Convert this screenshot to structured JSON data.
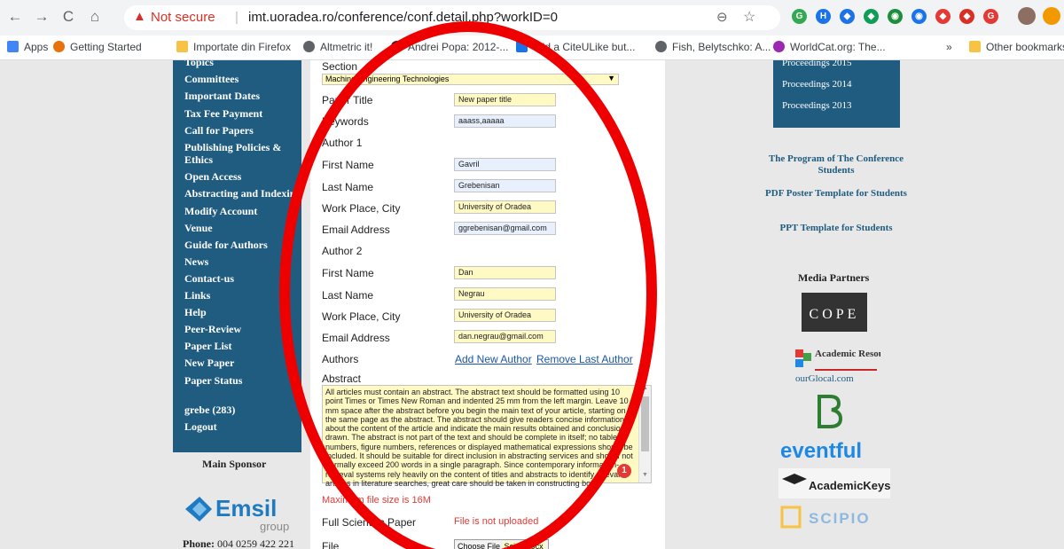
{
  "browser": {
    "back": "←",
    "forward": "→",
    "reload": "C",
    "home": "⌂",
    "warning_icon": "▲",
    "security_label": "Not secure",
    "url_separator": "|",
    "url": "imt.uoradea.ro/conference/conf.detail.php?workID=0",
    "zoom_icon": "⊖",
    "star_icon": "☆",
    "extensions": [
      "G",
      "H",
      "◆",
      "◆",
      "◉",
      "◉",
      "◆",
      "◆",
      "G"
    ],
    "extension_colors": [
      "#34a853",
      "#1a73e8",
      "#1a73e8",
      "#0f9d58",
      "#1e8e3e",
      "#1a73e8",
      "#e53935",
      "#d93025",
      "#e53935"
    ]
  },
  "bookmarks": {
    "items": [
      "Apps",
      "Getting Started",
      "Importate din Firefox",
      "Altmetric it!",
      "Andrei Popa: 2012-...",
      "add a CiteULike but...",
      "Fish, Belytschko: A...",
      "WorldCat.org: The..."
    ],
    "overflow": "»",
    "other": "Other bookmarks"
  },
  "left_nav": {
    "items": [
      "Topics",
      "Committees",
      "Important Dates",
      "Tax Fee Payment",
      "Call for Papers",
      "Publishing Policies &",
      "Ethics",
      "Open Access",
      "Abstracting and Indexing",
      "Modify Account",
      "Venue",
      "Guide for Authors",
      "News",
      "Contact-us",
      "Links",
      "Help",
      "Peer-Review",
      "Paper List",
      "New Paper",
      "Paper Status"
    ],
    "user": "grebe (283)",
    "logout": "Logout"
  },
  "sponsor": {
    "title": "Main Sponsor",
    "logo_text": "Emsil",
    "logo_sub": "group",
    "phone_label": "Phone:",
    "phone": "004 0259 422 221"
  },
  "form": {
    "section_label": "Section",
    "section_value": "Machine Engineering Technologies",
    "paper_title_label": "Paper Title",
    "paper_title_value": "New paper title",
    "keywords_label": "Keywords",
    "keywords_value": "aaass,aaaaa",
    "author1_heading": "Author 1",
    "author1": {
      "first_label": "First Name",
      "first": "Gavril",
      "last_label": "Last Name",
      "last": "Grebenisan",
      "work_label": "Work Place, City",
      "work": "University of Oradea",
      "email_label": "Email Address",
      "email": "ggrebenisan@gmail.com"
    },
    "author2_heading": "Author 2",
    "author2": {
      "first_label": "First Name",
      "first": "Dan",
      "last_label": "Last Name",
      "last": "Negrau",
      "work_label": "Work Place, City",
      "work": "University of Oradea",
      "email_label": "Email Address",
      "email": "dan.negrau@gmail.com"
    },
    "authors_label": "Authors",
    "add_author": "Add New Author",
    "remove_author": "Remove Last Author",
    "abstract_label": "Abstract",
    "abstract_text": "All articles must contain an abstract. The abstract text should be formatted using 10 point Times or Times New Roman and indented 25 mm from the left margin. Leave 10 mm space after the abstract before you begin the main text of your article, starting on the same page as the abstract. The abstract should give readers concise information about the content of the article and indicate the main results obtained and conclusions drawn. The abstract is not part of the text and should be complete in itself; no table numbers, figure numbers, references or displayed mathematical expressions should be included. It should be suitable for direct inclusion in abstracting services and should not normally exceed 200 words in a single paragraph. Since contemporary information-retrieval systems rely heavily on the content of titles and abstracts to identify relevant articles in literature searches, great care should be taken in constructing both.",
    "grammar_count": "1",
    "max_file": "Maximum file size is 16M",
    "full_paper_label": "Full Scientific Paper",
    "file_status": "File is not uploaded",
    "file_label": "File",
    "choose_file": "Choose File",
    "file_name": "Scie...docx"
  },
  "right_sidebar": {
    "proceedings": [
      "Proceedings 2015",
      "Proceedings 2014",
      "Proceedings 2013"
    ],
    "program_link": "The Program of The Conference Students",
    "poster_link": "PDF Poster Template for Students",
    "ppt_link": "PPT Template for Students",
    "media_title": "Media Partners",
    "partners": [
      "COPE",
      "Academic Resources",
      "ourGlocal.com",
      "eventful",
      "AcademicKeys",
      "SCIPIO"
    ]
  },
  "colors": {
    "nav_blue": "#1f5c80",
    "annotation_red": "#ee0000",
    "input_yellow": "#fff9c4",
    "input_blue": "#e8f0fe"
  }
}
